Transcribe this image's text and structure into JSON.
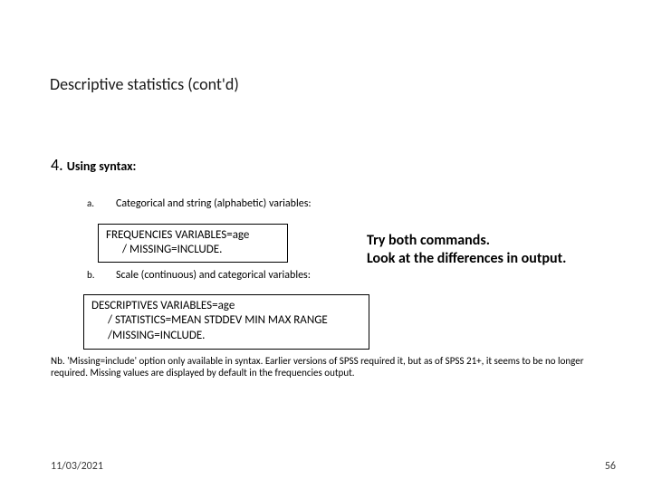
{
  "title": "Descriptive statistics (cont'd)",
  "section": {
    "num": "4.",
    "label": "Using syntax:"
  },
  "items": {
    "a": {
      "marker": "a.",
      "text": "Categorical and string (alphabetic) variables:",
      "code_line1": "FREQUENCIES VARIABLES=age",
      "code_line2": "/ MISSING=INCLUDE."
    },
    "b": {
      "marker": "b.",
      "text": "Scale (continuous) and categorical variables:",
      "code_line1": "DESCRIPTIVES VARIABLES=age",
      "code_line2": "/ STATISTICS=MEAN STDDEV MIN MAX RANGE",
      "code_line3": "/MISSING=INCLUDE."
    }
  },
  "side_note": {
    "line1": "Try both commands.",
    "line2": "Look at the differences in output."
  },
  "footnote": "Nb. 'Missing=include' option only available in syntax. Earlier versions of SPSS required it, but as of SPSS 21+, it seems to be no longer required. Missing values are displayed by default in the frequencies output.",
  "footer": {
    "date": "11/03/2021",
    "page": "56"
  }
}
